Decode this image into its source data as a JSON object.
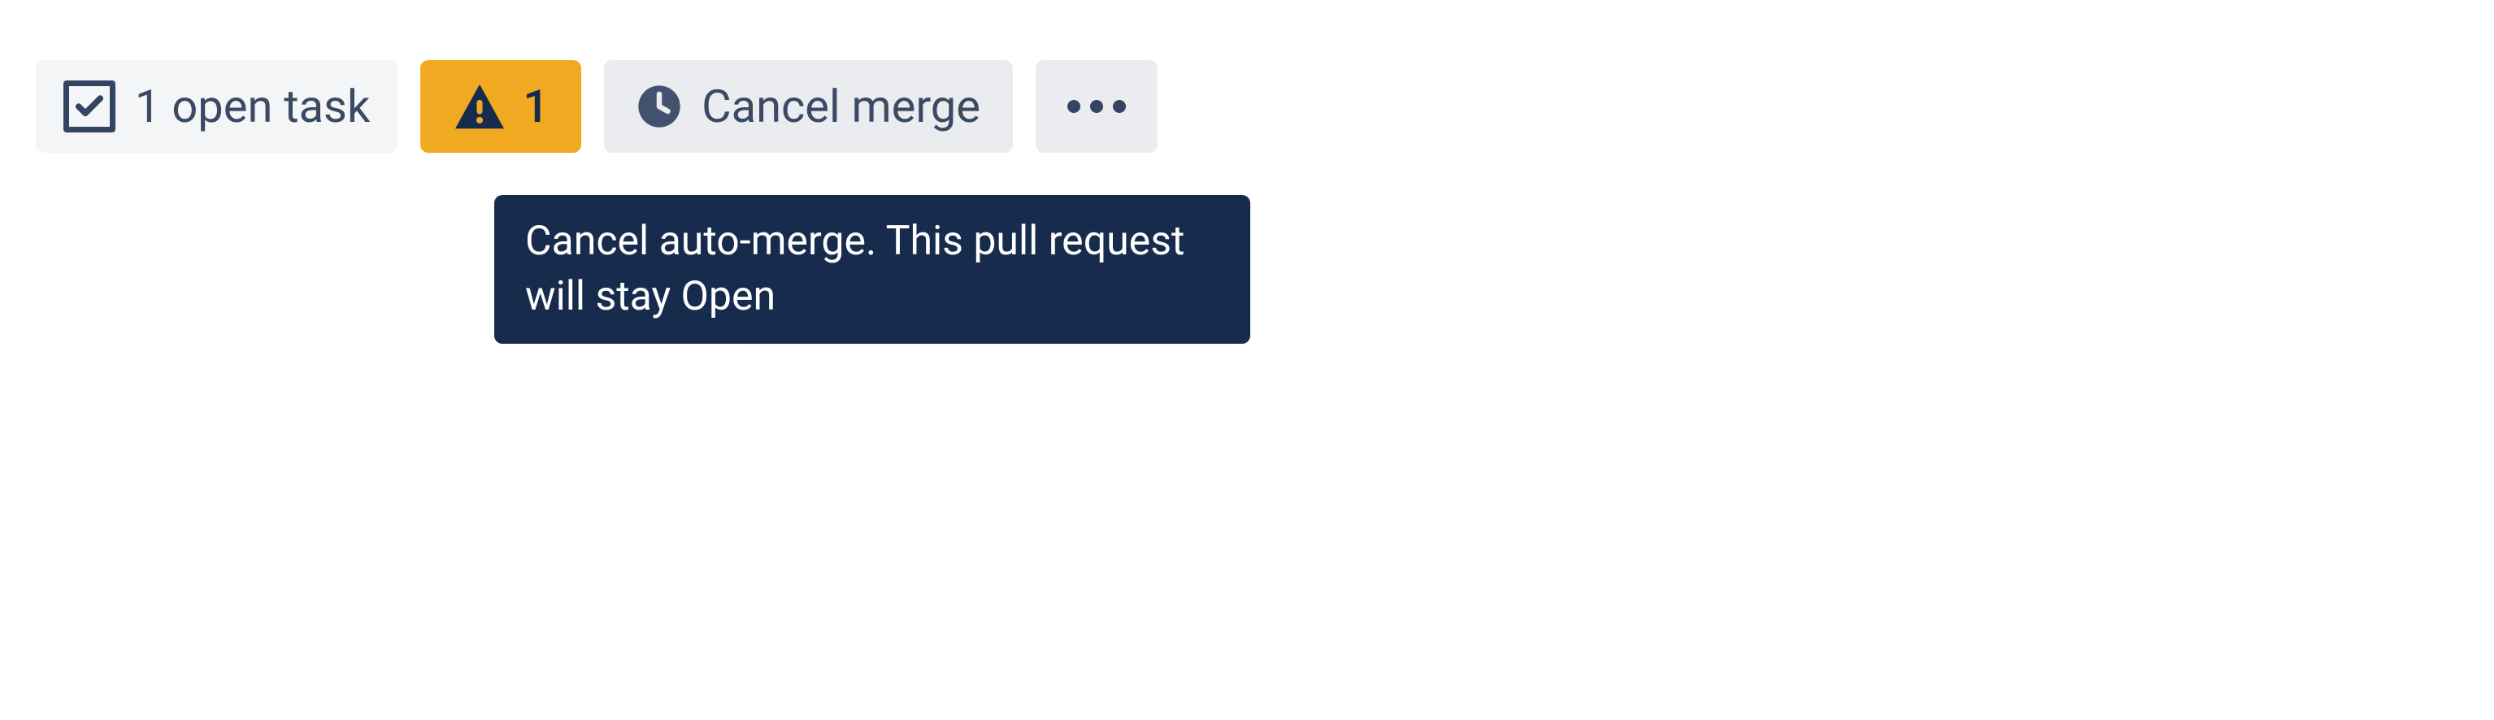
{
  "toolbar": {
    "open_tasks": {
      "label": "1 open task"
    },
    "warning": {
      "count": "1"
    },
    "cancel_merge": {
      "label": "Cancel merge"
    }
  },
  "tooltip": {
    "text": "Cancel auto-merge. This pull request will stay Open"
  }
}
